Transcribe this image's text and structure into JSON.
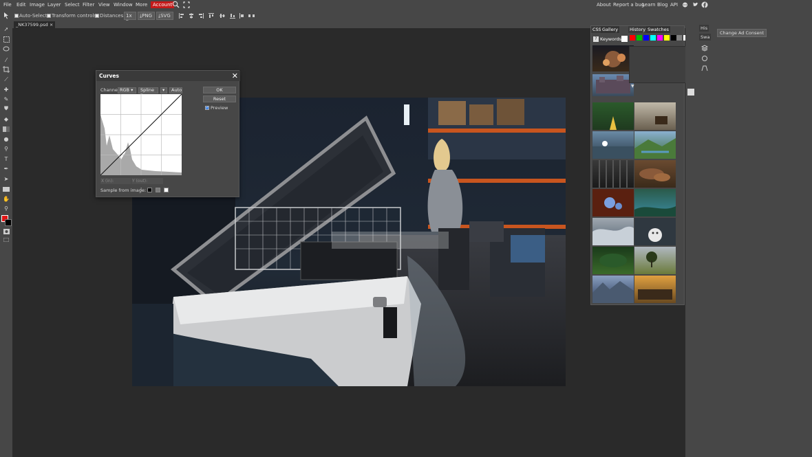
{
  "menubar": {
    "items": [
      "File",
      "Edit",
      "Image",
      "Layer",
      "Select",
      "Filter",
      "View",
      "Window",
      "More"
    ],
    "account": "Account",
    "links": [
      "About",
      "Report a bug",
      "Learn",
      "Blog",
      "API"
    ]
  },
  "ad_consent": "Change Ad Consent",
  "options": {
    "auto_select": "Auto-Select",
    "transform_controls": "Transform controls",
    "distances": "Distances",
    "zoom": "1x",
    "png": "PNG",
    "svg": "SVG"
  },
  "document": {
    "tab": "_NK37599.psd"
  },
  "curves": {
    "title": "Curves",
    "channel_label": "Channel:",
    "channel_value": "RGB",
    "mode_value": "Spline",
    "auto": "Auto",
    "ok": "OK",
    "reset": "Reset",
    "preview": "Preview",
    "x_in": "X (in):",
    "y_out": "Y (out):",
    "sample": "Sample from image:"
  },
  "panel": {
    "tabs": [
      "CSS",
      "Gallery",
      "History",
      "Swatches"
    ],
    "keywords": "Keywords:",
    "help": "?",
    "swatches": [
      "#ff0000",
      "#00c000",
      "#0000ff",
      "#00ffff",
      "#ff00ff",
      "#ffff00",
      "#000000",
      "#808080",
      "#ffffff",
      "#000000"
    ]
  },
  "right_strip": {
    "his": "His",
    "swa": "Swa"
  },
  "colors": {
    "primary": "#e01515",
    "secondary": "#000000",
    "accent": "#c41a1a"
  }
}
